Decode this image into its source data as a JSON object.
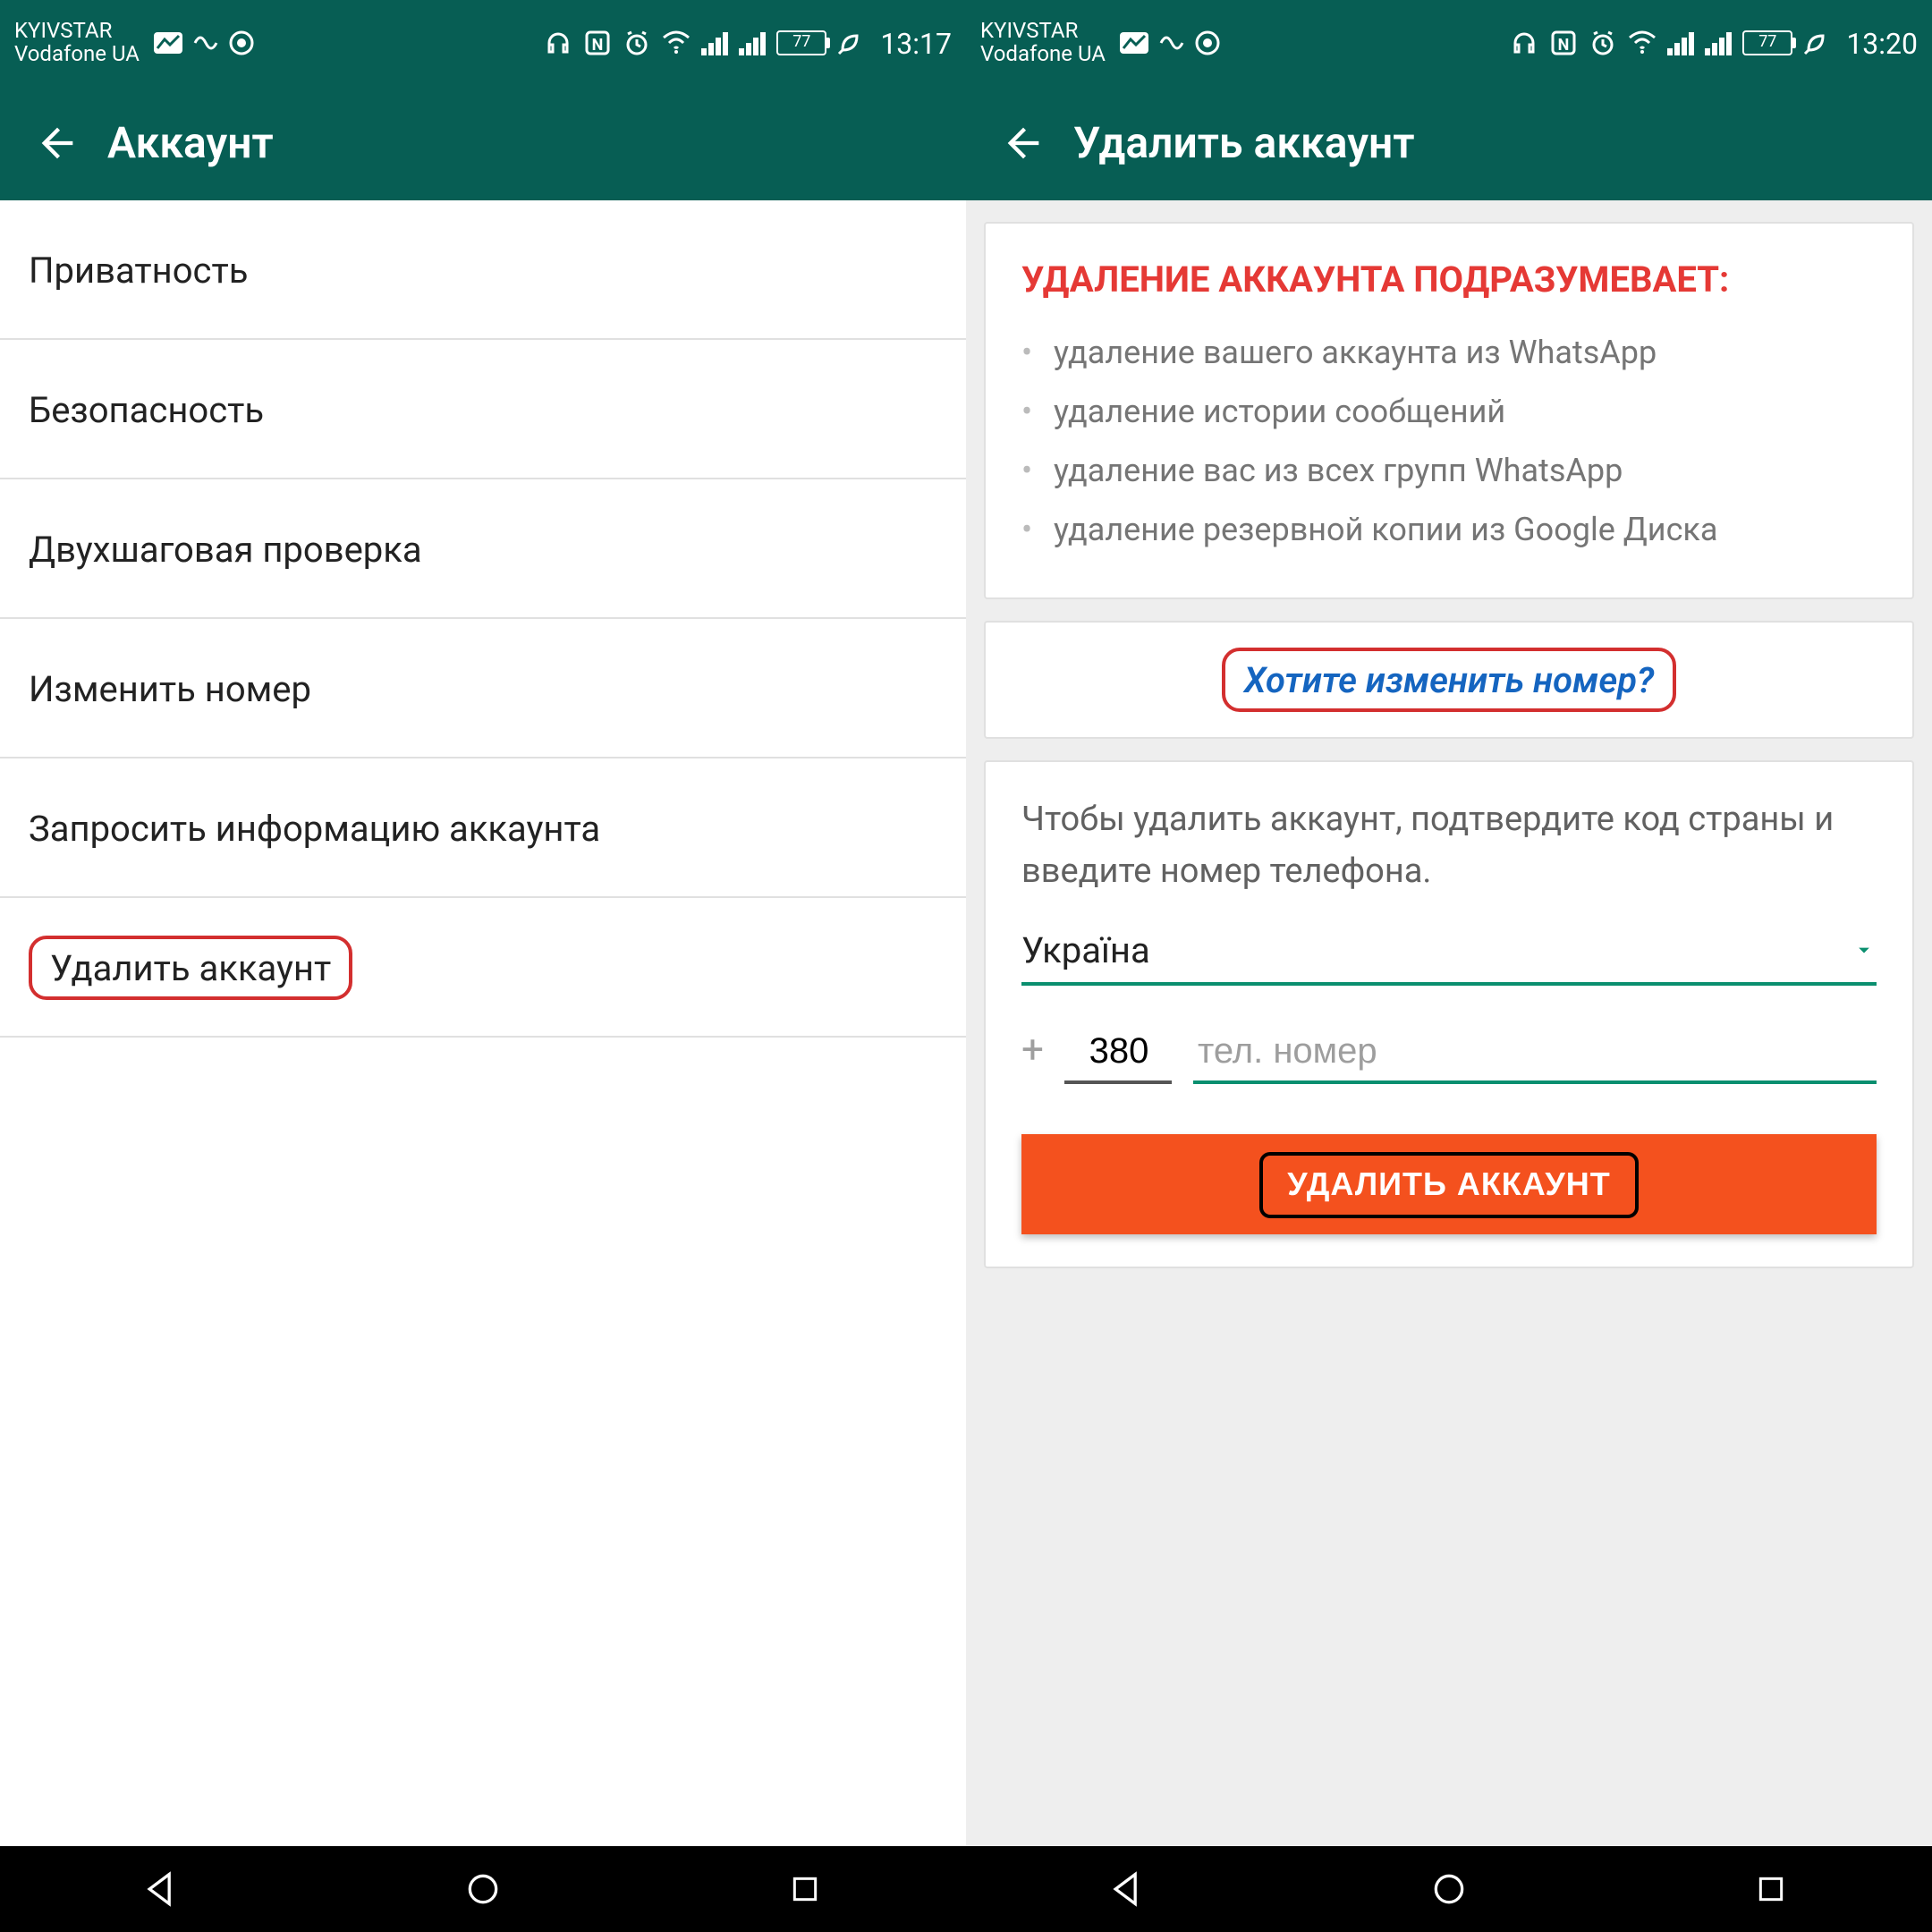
{
  "left": {
    "status": {
      "carrier1": "KYIVSTAR",
      "carrier2": "Vodafone UA",
      "battery": "77",
      "time": "13:17"
    },
    "title": "Аккаунт",
    "items": [
      "Приватность",
      "Безопасность",
      "Двухшаговая проверка",
      "Изменить номер",
      "Запросить информацию аккаунта",
      "Удалить аккаунт"
    ]
  },
  "right": {
    "status": {
      "carrier1": "KYIVSTAR",
      "carrier2": "Vodafone UA",
      "battery": "77",
      "time": "13:20"
    },
    "title": "Удалить аккаунт",
    "warn_heading": "УДАЛЕНИЕ АККАУНТА ПОДРАЗУМЕВАЕТ:",
    "bullets": [
      "удаление вашего аккаунта из WhatsApp",
      "удаление истории сообщений",
      "удаление вас из всех групп WhatsApp",
      "удаление резервной копии из Google Диска"
    ],
    "change_number": "Хотите изменить номер?",
    "instruction": "Чтобы удалить аккаунт, подтвердите код страны и введите номер телефона.",
    "country": "Україна",
    "country_code": "380",
    "phone_placeholder": "тел. номер",
    "delete_button": "УДАЛИТЬ АККАУНТ"
  }
}
